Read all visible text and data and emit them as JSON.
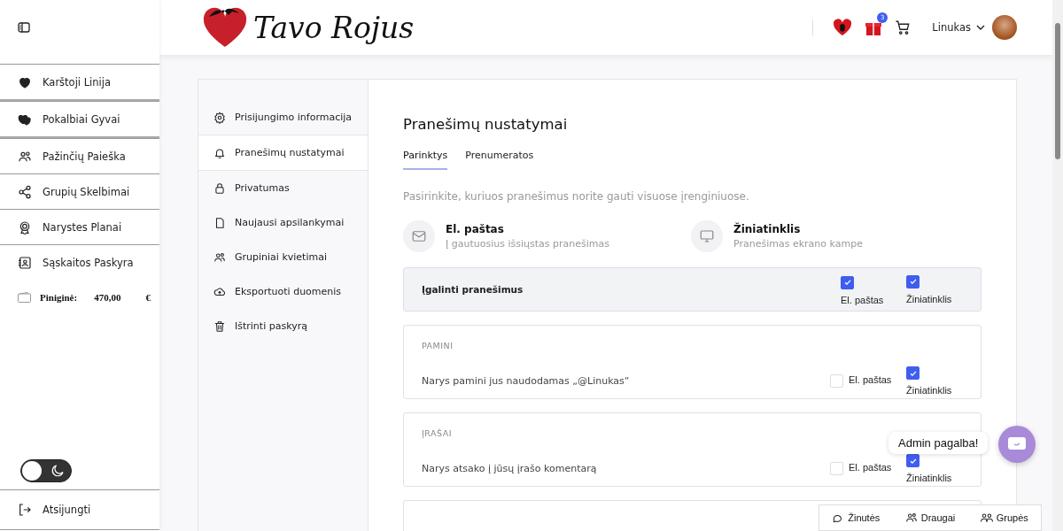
{
  "sidebar": {
    "items": [
      {
        "label": "Karštoji Linija"
      },
      {
        "label": "Pokalbiai Gyvai"
      },
      {
        "label": "Pažinčių Paieška"
      },
      {
        "label": "Grupių Skelbimai"
      },
      {
        "label": "Narystes Planai"
      },
      {
        "label": "Sąskaitos Paskyra"
      }
    ],
    "wallet": {
      "label": "Piniginė:",
      "amount": "470,00",
      "currency": "€"
    },
    "dark_mode_toggle": {
      "on": false
    },
    "logout": "Atsijungti"
  },
  "header": {
    "logo_text": "Tavo Rojus",
    "gift_badge": "3",
    "user_name": "Linukas"
  },
  "settings_nav": [
    {
      "label": "Prisijungimo informacija",
      "selected": false
    },
    {
      "label": "Pranešimų nustatymai",
      "selected": true
    },
    {
      "label": "Privatumas",
      "selected": false
    },
    {
      "label": "Naujausi apsilankymai",
      "selected": false
    },
    {
      "label": "Grupiniai kvietimai",
      "selected": false
    },
    {
      "label": "Eksportuoti duomenis",
      "selected": false
    },
    {
      "label": "Ištrinti paskyrą",
      "selected": false
    }
  ],
  "content": {
    "title": "Pranešimų nustatymai",
    "tabs": [
      {
        "label": "Parinktys",
        "selected": true
      },
      {
        "label": "Prenumeratos",
        "selected": false
      }
    ],
    "description": "Pasirinkite, kuriuos pranešimus norite gauti visuose įrenginiuose.",
    "channels": [
      {
        "title": "El. paštas",
        "subtitle": "Į gautuosius išsiųstas pranešimas"
      },
      {
        "title": "Žiniatinklis",
        "subtitle": "Pranešimas ekrano kampe"
      }
    ],
    "enable_row": {
      "label": "Įgalinti pranešimus",
      "email": {
        "label": "El. paštas",
        "checked": true
      },
      "web": {
        "label": "Žiniatinklis",
        "checked": true
      }
    },
    "sections": [
      {
        "heading": "PAMINI",
        "rows": [
          {
            "label": "Narys pamini jus naudodamas „@Linukas“",
            "email": {
              "label": "El. paštas",
              "checked": false
            },
            "web": {
              "label": "Žiniatinklis",
              "checked": true
            }
          }
        ]
      },
      {
        "heading": "ĮRAŠAI",
        "rows": [
          {
            "label": "Narys atsako į jūsų įrašo komentarą",
            "email": {
              "label": "El. paštas",
              "checked": false
            },
            "web": {
              "label": "Žiniatinklis",
              "checked": true
            }
          }
        ]
      }
    ]
  },
  "chat": {
    "label": "Admin pagalba!"
  },
  "bottom_bar": [
    {
      "label": "Žinutės"
    },
    {
      "label": "Draugai"
    },
    {
      "label": "Grupės"
    }
  ]
}
